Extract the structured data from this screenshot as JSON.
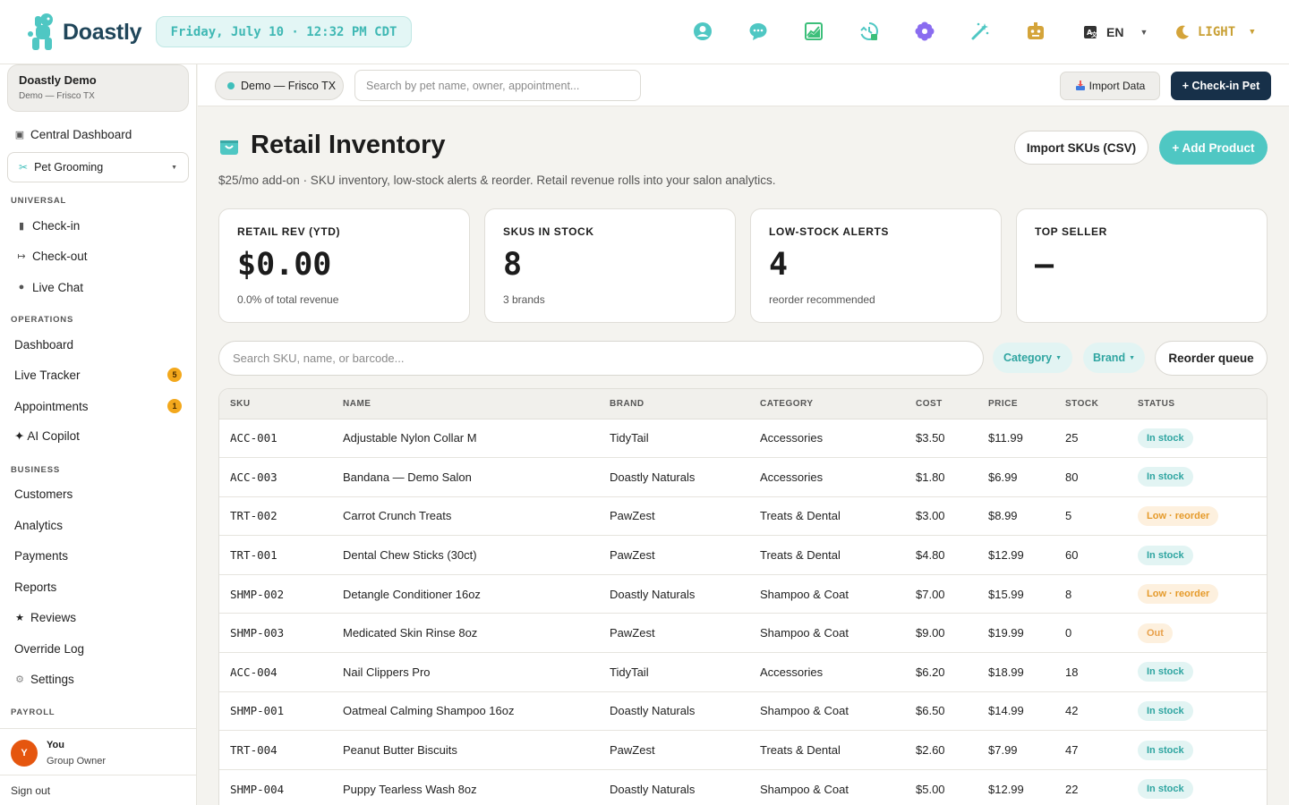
{
  "header": {
    "brand": "Doastly",
    "datetime": "Friday, July 10 · 12:32 PM CDT",
    "icons": [
      "support-icon",
      "chat-bubble-icon",
      "chart-icon",
      "history-clock-icon",
      "flower-icon",
      "magic-wand-icon",
      "robot-icon"
    ],
    "language": "EN",
    "theme": "LIGHT"
  },
  "sidebar": {
    "org_name": "Doastly Demo",
    "org_sub": "Demo — Frisco TX",
    "central": "Central Dashboard",
    "business_select": "Pet Grooming",
    "sections": {
      "universal": "UNIVERSAL",
      "operations": "OPERATIONS",
      "business": "BUSINESS",
      "payroll": "PAYROLL"
    },
    "universal_items": [
      "Check-in",
      "Check-out",
      "Live Chat"
    ],
    "operations_items": [
      "Dashboard",
      "Live Tracker",
      "Appointments",
      "✦ AI Copilot"
    ],
    "badges": {
      "live_tracker": "5",
      "appointments": "1"
    },
    "business_items": [
      "Customers",
      "Analytics",
      "Payments",
      "Reports",
      "Reviews",
      "Override Log",
      "Settings"
    ],
    "user_initial": "Y",
    "user_name": "You",
    "user_role": "Group Owner",
    "sign_out": "Sign out"
  },
  "subbar": {
    "location": "Demo — Frisco TX",
    "search_placeholder": "Search by pet name, owner, appointment...",
    "import_label": "Import Data",
    "checkin_label": "+ Check-in Pet"
  },
  "main": {
    "title": "Retail Inventory",
    "subtitle": "$25/mo add-on · SKU inventory, low-stock alerts & reorder. Retail revenue rolls into your salon analytics.",
    "import_skus": "Import SKUs (CSV)",
    "add_product": "+ Add Product",
    "stats": [
      {
        "label": "RETAIL REV (YTD)",
        "value": "$0.00",
        "sub": "0.0% of total revenue"
      },
      {
        "label": "SKUS IN STOCK",
        "value": "8",
        "sub": "3 brands"
      },
      {
        "label": "LOW-STOCK ALERTS",
        "value": "4",
        "sub": "reorder recommended"
      },
      {
        "label": "TOP SELLER",
        "value": "–",
        "sub": ""
      }
    ],
    "sku_search_placeholder": "Search SKU, name, or barcode...",
    "filter_category": "Category",
    "filter_brand": "Brand",
    "reorder_queue": "Reorder queue"
  },
  "table": {
    "headers": [
      "SKU",
      "NAME",
      "BRAND",
      "CATEGORY",
      "COST",
      "PRICE",
      "STOCK",
      "STATUS"
    ],
    "rows": [
      [
        "ACC-001",
        "Adjustable Nylon Collar M",
        "TidyTail",
        "Accessories",
        "$3.50",
        "$11.99",
        "25",
        "In stock"
      ],
      [
        "ACC-003",
        "Bandana — Demo Salon",
        "Doastly Naturals",
        "Accessories",
        "$1.80",
        "$6.99",
        "80",
        "In stock"
      ],
      [
        "TRT-002",
        "Carrot Crunch Treats",
        "PawZest",
        "Treats & Dental",
        "$3.00",
        "$8.99",
        "5",
        "Low · reorder"
      ],
      [
        "TRT-001",
        "Dental Chew Sticks (30ct)",
        "PawZest",
        "Treats & Dental",
        "$4.80",
        "$12.99",
        "60",
        "In stock"
      ],
      [
        "SHMP-002",
        "Detangle Conditioner 16oz",
        "Doastly Naturals",
        "Shampoo & Coat",
        "$7.00",
        "$15.99",
        "8",
        "Low · reorder"
      ],
      [
        "SHMP-003",
        "Medicated Skin Rinse 8oz",
        "PawZest",
        "Shampoo & Coat",
        "$9.00",
        "$19.99",
        "0",
        "Out"
      ],
      [
        "ACC-004",
        "Nail Clippers Pro",
        "TidyTail",
        "Accessories",
        "$6.20",
        "$18.99",
        "18",
        "In stock"
      ],
      [
        "SHMP-001",
        "Oatmeal Calming Shampoo 16oz",
        "Doastly Naturals",
        "Shampoo & Coat",
        "$6.50",
        "$14.99",
        "42",
        "In stock"
      ],
      [
        "TRT-004",
        "Peanut Butter Biscuits",
        "PawZest",
        "Treats & Dental",
        "$2.60",
        "$7.99",
        "47",
        "In stock"
      ],
      [
        "SHMP-004",
        "Puppy Tearless Wash 8oz",
        "Doastly Naturals",
        "Shampoo & Coat",
        "$5.00",
        "$12.99",
        "22",
        "In stock"
      ]
    ]
  },
  "colors": {
    "accent_teal": "#4fc7c3",
    "navy": "#173049",
    "in_stock_bg": "#e2f4f3",
    "in_stock_fg": "#2fa5a1",
    "low_bg": "#fdf0de",
    "low_fg": "#e59a2a",
    "out_bg": "#fdf0de",
    "out_fg": "#e8a04a"
  }
}
